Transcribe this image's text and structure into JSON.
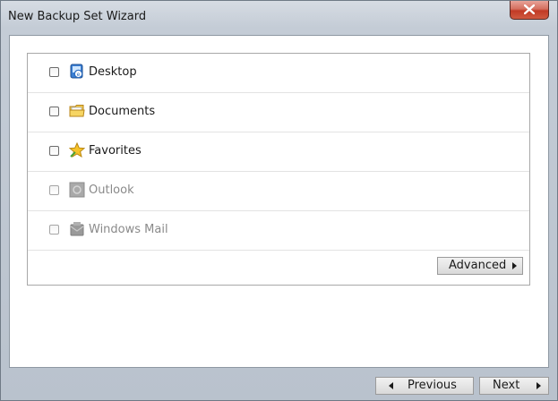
{
  "window": {
    "title": "New Backup Set Wizard"
  },
  "sources": [
    {
      "label": "Desktop",
      "icon": "desktop-icon",
      "checked": false,
      "enabled": true
    },
    {
      "label": "Documents",
      "icon": "documents-folder-icon",
      "checked": false,
      "enabled": true
    },
    {
      "label": "Favorites",
      "icon": "favorites-star-icon",
      "checked": false,
      "enabled": true
    },
    {
      "label": "Outlook",
      "icon": "outlook-icon",
      "checked": false,
      "enabled": false
    },
    {
      "label": "Windows Mail",
      "icon": "windows-mail-icon",
      "checked": false,
      "enabled": false
    }
  ],
  "buttons": {
    "advanced": "Advanced",
    "previous": "Previous",
    "next": "Next"
  },
  "colors": {
    "close_button": "#c13a26",
    "disabled_text": "#8a8a8a"
  }
}
